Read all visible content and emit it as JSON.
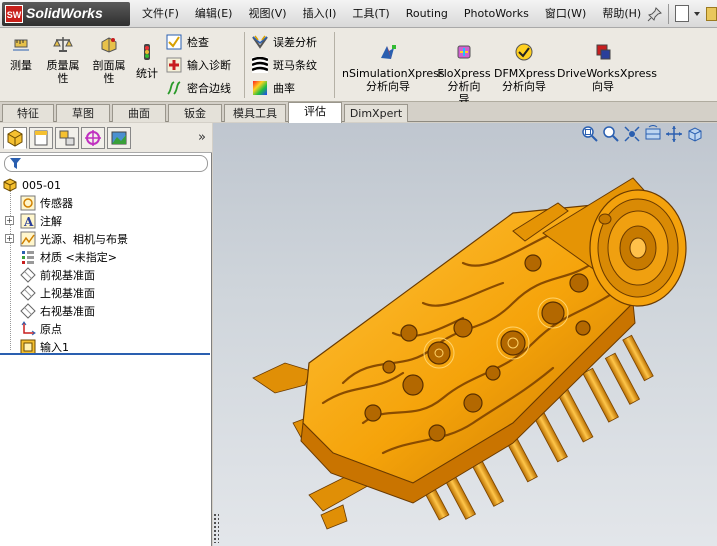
{
  "app": {
    "logo_text": "SolidWorks",
    "logo_mark": "SW"
  },
  "menu": [
    "文件(F)",
    "编辑(E)",
    "视图(V)",
    "插入(I)",
    "工具(T)",
    "Routing",
    "PhotoWorks",
    "窗口(W)",
    "帮助(H)"
  ],
  "toolbar": {
    "measure": "测量",
    "mass_props_1": "质量属",
    "mass_props_2": "性",
    "section_props_1": "剖面属",
    "section_props_2": "性",
    "statistics": "统计",
    "check": "检查",
    "import_diag": "输入诊断",
    "close_edges": "密合边线",
    "deviation": "误差分析",
    "zebra": "斑马条纹",
    "curvature": "曲率",
    "nsim_1": "nSimulationXpress",
    "nsim_2": "分析向导",
    "flo_1": "FloXpress",
    "flo_2": "分析向",
    "flo_3": "导",
    "dfm_1": "DFMXpress",
    "dfm_2": "分析向导",
    "drive_1": "DriveWorksXpress",
    "drive_2": "向导"
  },
  "tabs": [
    "特征",
    "草图",
    "曲面",
    "钣金",
    "模具工具",
    "评估",
    "DimXpert"
  ],
  "active_tab": "评估",
  "feature_tree": {
    "root": "005-01",
    "items": [
      "传感器",
      "注解",
      "光源、相机与布景",
      "材质 <未指定>",
      "前视基准面",
      "上视基准面",
      "右视基准面",
      "原点",
      "输入1"
    ]
  },
  "colors": {
    "part": "#f5a30a",
    "part_dark": "#9c5a00",
    "accent": "#2a5fb0"
  }
}
